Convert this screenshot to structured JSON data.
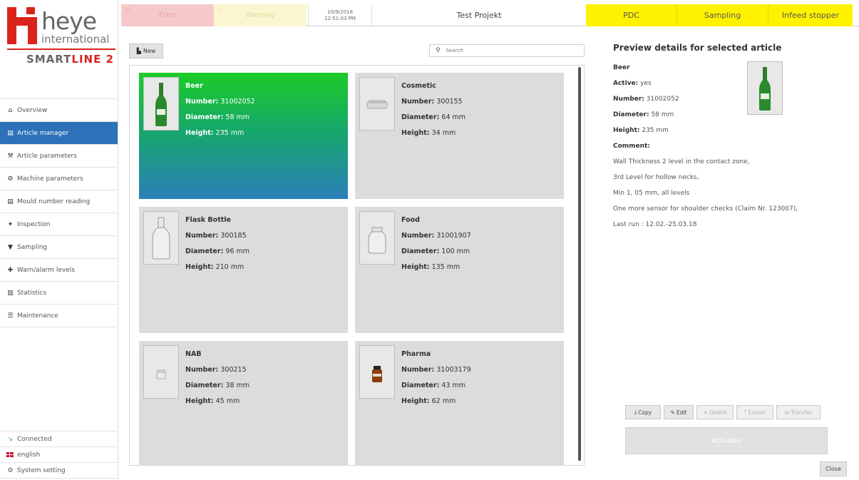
{
  "brand": {
    "name": "heye",
    "sub": "international",
    "product_main": "SMART",
    "product_accent": "LINE 2"
  },
  "sidebar": {
    "items": [
      {
        "label": "Overview",
        "icon": "home-icon",
        "glyph": "⌂"
      },
      {
        "label": "Article manager",
        "icon": "print-icon",
        "glyph": "▤",
        "active": true
      },
      {
        "label": "Article parameters",
        "icon": "wrench-icon",
        "glyph": "⚒"
      },
      {
        "label": "Machine parameters",
        "icon": "gear-icon",
        "glyph": "⚙"
      },
      {
        "label": "Mould number reading",
        "icon": "print-icon",
        "glyph": "▤"
      },
      {
        "label": "Inspection",
        "icon": "arrow-icon",
        "glyph": "✦"
      },
      {
        "label": "Sampling",
        "icon": "pin-icon",
        "glyph": "▼"
      },
      {
        "label": "Warn/alarm levels",
        "icon": "flag-icon",
        "glyph": "✚"
      },
      {
        "label": "Statistics",
        "icon": "bar-chart-icon",
        "glyph": "▥"
      },
      {
        "label": "Maintenance",
        "icon": "list-icon",
        "glyph": "☰"
      }
    ],
    "bottom": {
      "connection": "Connected",
      "language": "english",
      "system": "System setting"
    }
  },
  "topbar": {
    "error": "Error",
    "warning": "Warning",
    "date": "10/9/2018",
    "time": "12:51:03 PM",
    "project": "Test Projekt",
    "pdc": "PDC",
    "sampling": "Sampling",
    "infeed": "Infeed stopper"
  },
  "toolbar": {
    "new_label": "New",
    "search_placeholder": "Search"
  },
  "labels": {
    "number": "Number:",
    "diameter": "Diameter:",
    "height": "Height:",
    "active": "Active:",
    "comment": "Comment:"
  },
  "articles": [
    {
      "name": "Beer",
      "number": "31002052",
      "diameter": "58 mm",
      "height": "235 mm",
      "bottle": "green-beer-bottle"
    },
    {
      "name": "Cosmetic",
      "number": "300155",
      "diameter": "64 mm",
      "height": "34 mm",
      "bottle": "flat-jar"
    },
    {
      "name": "Flask Bottle",
      "number": "300185",
      "diameter": "96 mm",
      "height": "210 mm",
      "bottle": "flask"
    },
    {
      "name": "Food",
      "number": "31001907",
      "diameter": "100 mm",
      "height": "135 mm",
      "bottle": "food-jar"
    },
    {
      "name": "NAB",
      "number": "300215",
      "diameter": "38 mm",
      "height": "45 mm",
      "bottle": "small-jar"
    },
    {
      "name": "Pharma",
      "number": "31003179",
      "diameter": "43 mm",
      "height": "62 mm",
      "bottle": "amber-pharma-bottle"
    }
  ],
  "preview": {
    "title": "Preview details for selected article",
    "name": "Beer",
    "active": "yes",
    "number": "31002052",
    "diameter": "58 mm",
    "height": "235 mm",
    "comment_lines": [
      "Wall Thickness 2 level in the contact zone,",
      "3rd Level for hollow necks,",
      "Min 1, 05 mm, all levels",
      "One more sensor for shoulder checks (Claim Nr. 123007),",
      "Last run : 12.02.-25.03.18"
    ]
  },
  "actions": {
    "copy": "Copy",
    "edit": "Edit",
    "delete": "Delete",
    "export": "Export",
    "transfer": "Transfer",
    "activate": "Activate",
    "close": "Close"
  },
  "colors": {
    "accent_blue": "#2d72b8",
    "brand_red": "#d9231c",
    "status_yellow": "#fff200",
    "error_bg": "#f6c9c9",
    "warning_bg": "#fbf6d0"
  }
}
